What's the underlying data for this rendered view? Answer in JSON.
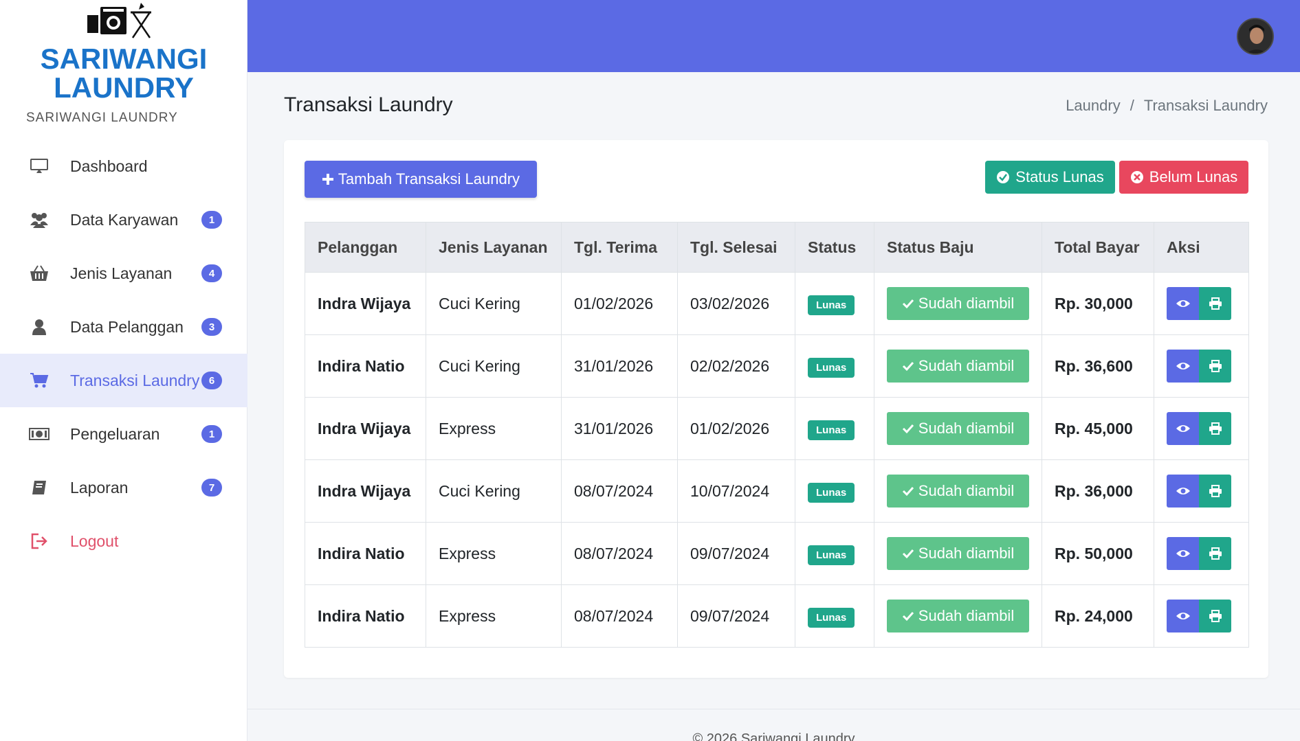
{
  "brand": {
    "logo_line1": "SARIWANGI",
    "logo_line2": "LAUNDRY",
    "subtitle": "SARIWANGI LAUNDRY",
    "logo_color": "#1a73c9"
  },
  "sidebar": {
    "items": [
      {
        "label": "Dashboard",
        "icon": "monitor-icon",
        "badge": ""
      },
      {
        "label": "Data Karyawan",
        "icon": "users-icon",
        "badge": "1"
      },
      {
        "label": "Jenis Layanan",
        "icon": "basket-icon",
        "badge": "4"
      },
      {
        "label": "Data Pelanggan",
        "icon": "user-icon",
        "badge": "3"
      },
      {
        "label": "Transaksi Laundry",
        "icon": "cart-icon",
        "badge": "6"
      },
      {
        "label": "Pengeluaran",
        "icon": "money-icon",
        "badge": "1"
      },
      {
        "label": "Laporan",
        "icon": "book-icon",
        "badge": "7"
      },
      {
        "label": "Logout",
        "icon": "logout-icon",
        "badge": ""
      }
    ]
  },
  "header": {
    "page_title": "Transaksi Laundry",
    "breadcrumb": [
      "Laundry",
      "/",
      "Transaksi Laundry"
    ]
  },
  "actions": {
    "add_label": "Tambah Transaksi Laundry",
    "status_lunas_label": "Status Lunas",
    "belum_lunas_label": "Belum Lunas"
  },
  "table": {
    "headers": [
      "Pelanggan",
      "Jenis Layanan",
      "Tgl. Terima",
      "Tgl. Selesai",
      "Status",
      "Status Baju",
      "Total Bayar",
      "Aksi"
    ],
    "rows": [
      {
        "pelanggan": "Indra Wijaya",
        "layanan": "Cuci Kering",
        "terima": "01/02/2026",
        "selesai": "03/02/2026",
        "status": "Lunas",
        "status_baju": "Sudah diambil",
        "total": "Rp. 30,000"
      },
      {
        "pelanggan": "Indira Natio",
        "layanan": "Cuci Kering",
        "terima": "31/01/2026",
        "selesai": "02/02/2026",
        "status": "Lunas",
        "status_baju": "Sudah diambil",
        "total": "Rp. 36,600"
      },
      {
        "pelanggan": "Indra Wijaya",
        "layanan": "Express",
        "terima": "31/01/2026",
        "selesai": "01/02/2026",
        "status": "Lunas",
        "status_baju": "Sudah diambil",
        "total": "Rp. 45,000"
      },
      {
        "pelanggan": "Indra Wijaya",
        "layanan": "Cuci Kering",
        "terima": "08/07/2024",
        "selesai": "10/07/2024",
        "status": "Lunas",
        "status_baju": "Sudah diambil",
        "total": "Rp. 36,000"
      },
      {
        "pelanggan": "Indira Natio",
        "layanan": "Express",
        "terima": "08/07/2024",
        "selesai": "09/07/2024",
        "status": "Lunas",
        "status_baju": "Sudah diambil",
        "total": "Rp. 50,000"
      },
      {
        "pelanggan": "Indira Natio",
        "layanan": "Express",
        "terima": "08/07/2024",
        "selesai": "09/07/2024",
        "status": "Lunas",
        "status_baju": "Sudah diambil",
        "total": "Rp. 24,000"
      }
    ]
  },
  "footer": {
    "text": "© 2026 Sariwangi Laundry"
  },
  "colors": {
    "primary": "#5b6ae4",
    "success": "#20a68b",
    "danger": "#e8475e",
    "taken": "#5ec48b"
  }
}
